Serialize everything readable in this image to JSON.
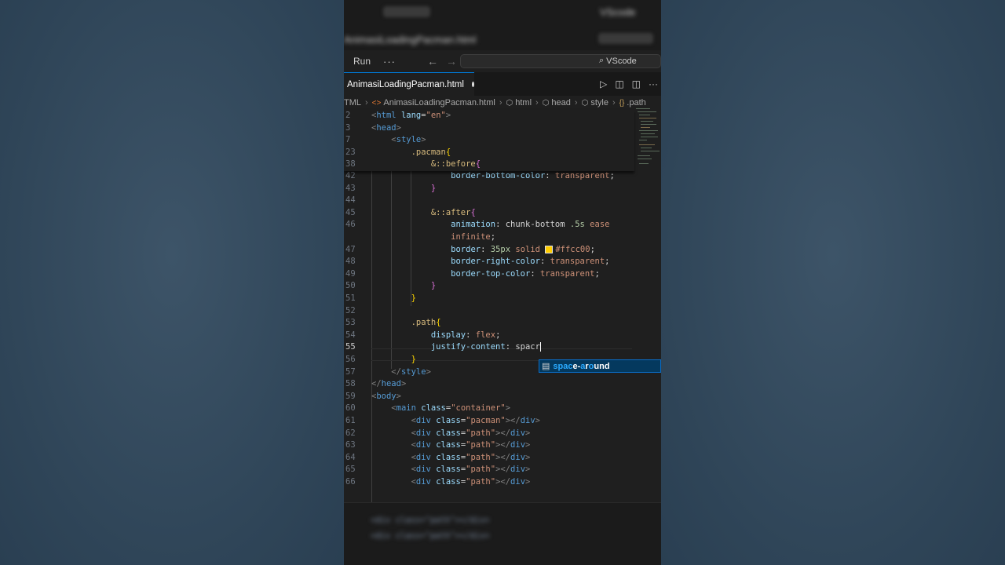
{
  "top_bar": {
    "blurred_tab": "AnimasiLoadingPacman.html",
    "blurred_search": "VScode"
  },
  "menubar": {
    "run_label": "Run",
    "more_label": "···",
    "back_icon": "←",
    "forward_icon": "→",
    "search_icon": "⌕",
    "search_label": "VScode"
  },
  "tab": {
    "filename": "AnimasiLoadingPacman.html",
    "unsaved": true
  },
  "breadcrumb": {
    "items": [
      "TML",
      "AnimasiLoadingPacman.html",
      "html",
      "head",
      "style",
      ".path"
    ]
  },
  "editor": {
    "sticky_lines": [
      {
        "num": "2",
        "html": "<span class='t-br'>&lt;</span><span class='t-tag'>html</span> <span class='t-attr'>lang</span><span class='t-txt'>=</span><span class='t-str'>\"en\"</span><span class='t-br'>&gt;</span>"
      },
      {
        "num": "3",
        "html": "<span class='t-br'>&lt;</span><span class='t-tag'>head</span><span class='t-br'>&gt;</span>"
      },
      {
        "num": "7",
        "html": "    <span class='t-br'>&lt;</span><span class='t-tag'>style</span><span class='t-br'>&gt;</span>"
      },
      {
        "num": "23",
        "html": "        <span class='t-sel'>.pacman</span><span class='t-brace1'>{</span>"
      },
      {
        "num": "38",
        "html": "            <span class='t-sel'>&amp;::before</span><span class='t-brace2'>{</span>"
      }
    ],
    "lines": [
      {
        "num": "42",
        "html": "                <span class='t-prop'>border-bottom-color</span><span class='t-txt'>: </span><span class='t-val'>transparent</span><span class='t-txt'>;</span>"
      },
      {
        "num": "43",
        "html": "            <span class='t-brace2'>}</span>"
      },
      {
        "num": "44",
        "html": ""
      },
      {
        "num": "45",
        "html": "            <span class='t-sel'>&amp;::after</span><span class='t-brace2'>{</span>"
      },
      {
        "num": "46",
        "html": "                <span class='t-prop'>animation</span><span class='t-txt'>: chunk-bottom </span><span class='t-num'>.5s</span><span class='t-val'> ease</span>"
      },
      {
        "num": "",
        "html": "                <span class='t-val'>infinite</span><span class='t-txt'>;</span>"
      },
      {
        "num": "47",
        "html": "                <span class='t-prop'>border</span><span class='t-txt'>: </span><span class='t-num'>35px</span><span class='t-val'> solid </span><span class='swatch'></span><span class='t-val'>#ffcc00</span><span class='t-txt'>;</span>"
      },
      {
        "num": "48",
        "html": "                <span class='t-prop'>border-right-color</span><span class='t-txt'>: </span><span class='t-val'>transparent</span><span class='t-txt'>;</span>"
      },
      {
        "num": "49",
        "html": "                <span class='t-prop'>border-top-color</span><span class='t-txt'>: </span><span class='t-val'>transparent</span><span class='t-txt'>;</span>"
      },
      {
        "num": "50",
        "html": "            <span class='t-brace2'>}</span>"
      },
      {
        "num": "51",
        "html": "        <span class='t-brace1'>}</span>"
      },
      {
        "num": "52",
        "html": ""
      },
      {
        "num": "53",
        "html": "        <span class='t-sel'>.path</span><span class='t-brace1'>{</span>"
      },
      {
        "num": "54",
        "html": "            <span class='t-prop'>display</span><span class='t-txt'>: </span><span class='t-val'>flex</span><span class='t-txt'>;</span>"
      },
      {
        "num": "55",
        "html": "            <span class='t-prop'>justify-content</span><span class='t-txt'>: spacr</span><span class='cursor'></span>",
        "current": true
      },
      {
        "num": "56",
        "html": "        <span class='t-brace1'>}</span>"
      },
      {
        "num": "57",
        "html": "    <span class='t-br'>&lt;/</span><span class='t-tag'>style</span><span class='t-br'>&gt;</span>"
      },
      {
        "num": "58",
        "html": "<span class='t-br'>&lt;/</span><span class='t-tag'>head</span><span class='t-br'>&gt;</span>"
      },
      {
        "num": "59",
        "html": "<span class='t-br'>&lt;</span><span class='t-tag'>body</span><span class='t-br'>&gt;</span>"
      },
      {
        "num": "60",
        "html": "    <span class='t-br'>&lt;</span><span class='t-tag'>main</span> <span class='t-attr'>class</span><span class='t-txt'>=</span><span class='t-str'>\"container\"</span><span class='t-br'>&gt;</span>"
      },
      {
        "num": "61",
        "html": "        <span class='t-br'>&lt;</span><span class='t-tag'>div</span> <span class='t-attr'>class</span><span class='t-txt'>=</span><span class='t-str'>\"pacman\"</span><span class='t-br'>&gt;&lt;/</span><span class='t-tag'>div</span><span class='t-br'>&gt;</span>"
      },
      {
        "num": "62",
        "html": "        <span class='t-br'>&lt;</span><span class='t-tag'>div</span> <span class='t-attr'>class</span><span class='t-txt'>=</span><span class='t-str'>\"path\"</span><span class='t-br'>&gt;&lt;/</span><span class='t-tag'>div</span><span class='t-br'>&gt;</span>"
      },
      {
        "num": "63",
        "html": "        <span class='t-br'>&lt;</span><span class='t-tag'>div</span> <span class='t-attr'>class</span><span class='t-txt'>=</span><span class='t-str'>\"path\"</span><span class='t-br'>&gt;&lt;/</span><span class='t-tag'>div</span><span class='t-br'>&gt;</span>"
      },
      {
        "num": "64",
        "html": "        <span class='t-br'>&lt;</span><span class='t-tag'>div</span> <span class='t-attr'>class</span><span class='t-txt'>=</span><span class='t-str'>\"path\"</span><span class='t-br'>&gt;&lt;/</span><span class='t-tag'>div</span><span class='t-br'>&gt;</span>"
      },
      {
        "num": "65",
        "html": "        <span class='t-br'>&lt;</span><span class='t-tag'>div</span> <span class='t-attr'>class</span><span class='t-txt'>=</span><span class='t-str'>\"path\"</span><span class='t-br'>&gt;&lt;/</span><span class='t-tag'>div</span><span class='t-br'>&gt;</span>"
      },
      {
        "num": "66",
        "html": "        <span class='t-br'>&lt;</span><span class='t-tag'>div</span> <span class='t-attr'>class</span><span class='t-txt'>=</span><span class='t-str'>\"path\"</span><span class='t-br'>&gt;&lt;/</span><span class='t-tag'>div</span><span class='t-br'>&gt;</span>"
      }
    ],
    "suggestion": {
      "icon": "property-icon",
      "match_1": "spac",
      "mid": "e-",
      "match_2": "a",
      "rest_1": "r",
      "match_3": "o",
      "rest_2": "und"
    }
  },
  "bottom_blurred": [
    "<div class=\"path\"></div>",
    "<div class=\"path\"></div>"
  ]
}
